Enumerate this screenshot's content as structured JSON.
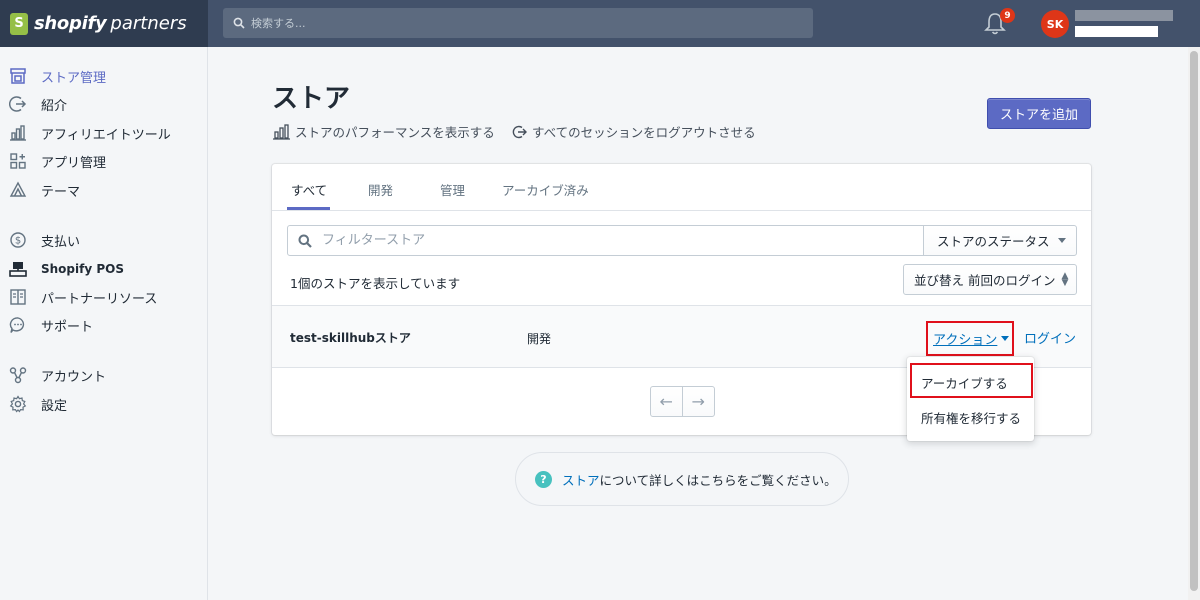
{
  "topbar": {
    "brand_main": "shopify",
    "brand_sub": "partners",
    "search_placeholder": "検索する...",
    "notification_count": "9",
    "avatar_initials": "SK"
  },
  "sidebar": {
    "items": [
      {
        "label": "ストア管理",
        "icon": "store-icon",
        "active": true
      },
      {
        "label": "紹介",
        "icon": "referral-icon"
      },
      {
        "label": "アフィリエイトツール",
        "icon": "chart-icon"
      },
      {
        "label": "アプリ管理",
        "icon": "apps-icon"
      },
      {
        "label": "テーマ",
        "icon": "theme-icon"
      },
      {
        "label": "支払い",
        "icon": "dollar-icon"
      },
      {
        "label": "Shopify POS",
        "icon": "pos-icon"
      },
      {
        "label": "パートナーリソース",
        "icon": "book-icon"
      },
      {
        "label": "サポート",
        "icon": "chat-icon"
      },
      {
        "label": "アカウント",
        "icon": "account-icon"
      },
      {
        "label": "設定",
        "icon": "gear-icon"
      }
    ]
  },
  "main": {
    "title": "ストア",
    "perf_link": "ストアのパフォーマンスを表示する",
    "logout_link": "すべてのセッションをログアウトさせる",
    "add_button": "ストアを追加",
    "tabs": [
      "すべて",
      "開発",
      "管理",
      "アーカイブ済み"
    ],
    "filter_placeholder": "フィルターストア",
    "status_select": "ストアのステータス",
    "count_text": "1個のストアを表示しています",
    "sort_select": "並び替え 前回のログイン",
    "store": {
      "name": "test-skillhubストア",
      "type": "開発",
      "action_label": "アクション",
      "login_label": "ログイン"
    },
    "dropdown": [
      "アーカイブする",
      "所有権を移行する"
    ],
    "help_link": "ストア",
    "help_text": "について詳しくはこちらをご覧ください。"
  },
  "colors": {
    "accent": "#5c6ac4",
    "link": "#006fbb",
    "highlight_border": "#e0101b"
  }
}
